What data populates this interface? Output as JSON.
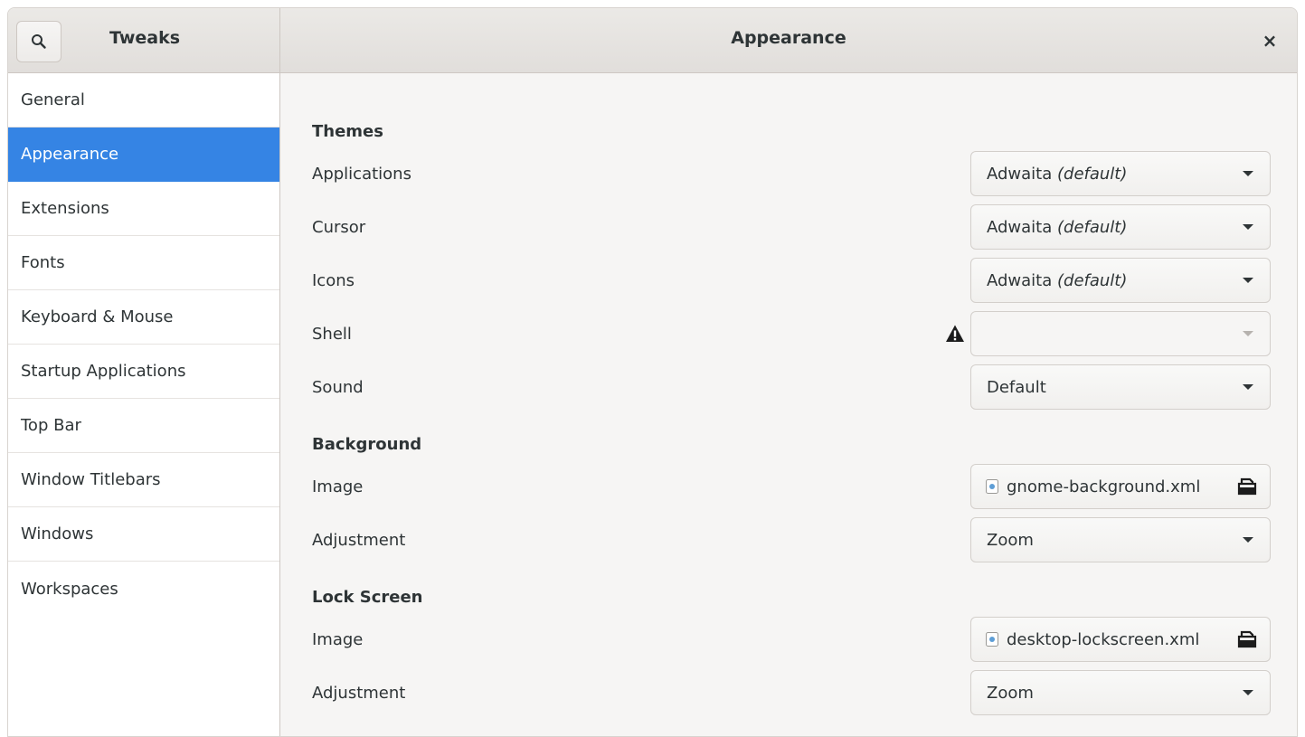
{
  "header": {
    "app_title": "Tweaks",
    "page_title": "Appearance",
    "search_icon": "search-icon",
    "close_label": "×"
  },
  "sidebar": {
    "items": [
      {
        "label": "General"
      },
      {
        "label": "Appearance",
        "selected": true
      },
      {
        "label": "Extensions"
      },
      {
        "label": "Fonts"
      },
      {
        "label": "Keyboard & Mouse"
      },
      {
        "label": "Startup Applications"
      },
      {
        "label": "Top Bar"
      },
      {
        "label": "Window Titlebars"
      },
      {
        "label": "Windows"
      },
      {
        "label": "Workspaces"
      }
    ]
  },
  "themes": {
    "heading": "Themes",
    "applications": {
      "label": "Applications",
      "value": "Adwaita ",
      "value_note": "(default)"
    },
    "cursor": {
      "label": "Cursor",
      "value": "Adwaita ",
      "value_note": "(default)"
    },
    "icons": {
      "label": "Icons",
      "value": "Adwaita ",
      "value_note": "(default)"
    },
    "shell": {
      "label": "Shell",
      "value": "",
      "warning_icon": "warning-icon"
    },
    "sound": {
      "label": "Sound",
      "value": "Default"
    }
  },
  "background": {
    "heading": "Background",
    "image": {
      "label": "Image",
      "value": "gnome-background.xml"
    },
    "adjustment": {
      "label": "Adjustment",
      "value": "Zoom"
    }
  },
  "lock_screen": {
    "heading": "Lock Screen",
    "image": {
      "label": "Image",
      "value": "desktop-lockscreen.xml"
    },
    "adjustment": {
      "label": "Adjustment",
      "value": "Zoom"
    }
  },
  "colors": {
    "accent": "#3584e4",
    "window_bg": "#f6f5f4",
    "text": "#2e3436"
  }
}
